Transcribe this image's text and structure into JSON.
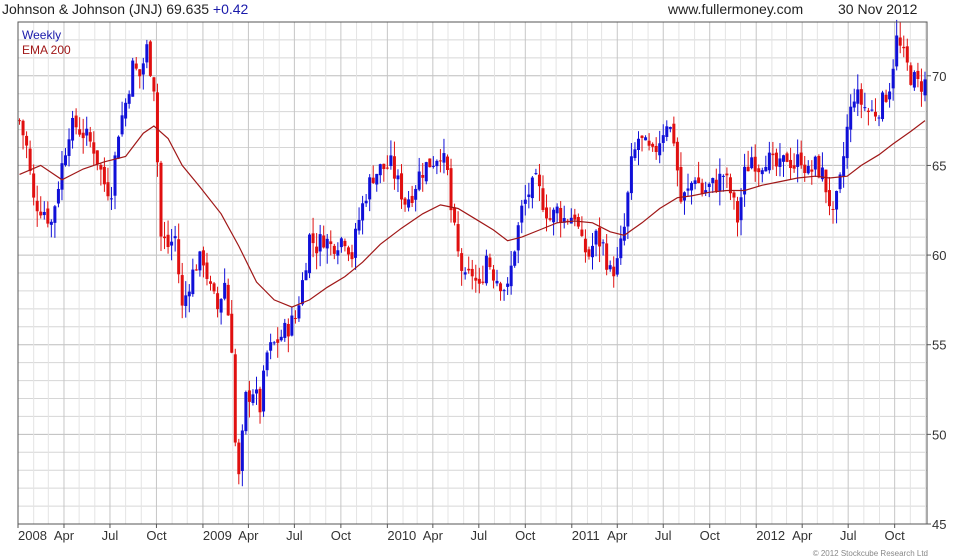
{
  "header": {
    "title": "Johnson & Johnson (JNJ)",
    "price": "69.635",
    "change": "+0.42",
    "site": "www.fullermoney.com",
    "date": "30 Nov 2012"
  },
  "legend": {
    "weekly": "Weekly",
    "ema": "EMA 200"
  },
  "copyright": "© 2012 Stockcube Research Ltd",
  "colors": {
    "up": "#1010d8",
    "down": "#e01010",
    "ema": "#a01818",
    "grid": "#d6d6d6",
    "axis": "#555555",
    "change": "#1a1aaa"
  },
  "chart_data": {
    "type": "candlestick",
    "frequency": "weekly",
    "ylim": [
      45,
      73
    ],
    "yticks": [
      45,
      50,
      55,
      60,
      65,
      70
    ],
    "xlim": [
      "2008-01-01",
      "2012-12-04"
    ],
    "xticks": [
      {
        "label": "2008",
        "date": "2008-01-01"
      },
      {
        "label": "Apr",
        "date": "2008-04-01"
      },
      {
        "label": "Jul",
        "date": "2008-07-01"
      },
      {
        "label": "Oct",
        "date": "2008-10-01"
      },
      {
        "label": "2009",
        "date": "2009-01-01"
      },
      {
        "label": "Apr",
        "date": "2009-04-01"
      },
      {
        "label": "Jul",
        "date": "2009-07-01"
      },
      {
        "label": "Oct",
        "date": "2009-10-01"
      },
      {
        "label": "2010",
        "date": "2010-01-01"
      },
      {
        "label": "Apr",
        "date": "2010-04-01"
      },
      {
        "label": "Jul",
        "date": "2010-07-01"
      },
      {
        "label": "Oct",
        "date": "2010-10-01"
      },
      {
        "label": "2011",
        "date": "2011-01-01"
      },
      {
        "label": "Apr",
        "date": "2011-04-01"
      },
      {
        "label": "Jul",
        "date": "2011-07-01"
      },
      {
        "label": "Oct",
        "date": "2011-10-01"
      },
      {
        "label": "2012",
        "date": "2012-01-01"
      },
      {
        "label": "Apr",
        "date": "2012-04-01"
      },
      {
        "label": "Jul",
        "date": "2012-07-01"
      },
      {
        "label": "Oct",
        "date": "2012-10-01"
      }
    ],
    "close_anchors": [
      [
        "2008-01-04",
        67.5
      ],
      [
        "2008-01-18",
        66.0
      ],
      [
        "2008-02-01",
        63.0
      ],
      [
        "2008-02-22",
        62.5
      ],
      [
        "2008-03-07",
        61.8
      ],
      [
        "2008-03-21",
        64.0
      ],
      [
        "2008-04-11",
        67.0
      ],
      [
        "2008-04-25",
        67.2
      ],
      [
        "2008-05-09",
        66.8
      ],
      [
        "2008-05-30",
        66.0
      ],
      [
        "2008-06-20",
        64.0
      ],
      [
        "2008-07-03",
        63.5
      ],
      [
        "2008-07-18",
        67.0
      ],
      [
        "2008-08-01",
        68.5
      ],
      [
        "2008-08-15",
        70.5
      ],
      [
        "2008-08-29",
        70.0
      ],
      [
        "2008-09-12",
        71.5
      ],
      [
        "2008-09-26",
        69.5
      ],
      [
        "2008-10-10",
        61.0
      ],
      [
        "2008-10-24",
        60.5
      ],
      [
        "2008-11-07",
        61.0
      ],
      [
        "2008-11-21",
        57.0
      ],
      [
        "2008-12-05",
        58.5
      ],
      [
        "2008-12-19",
        59.5
      ],
      [
        "2009-01-02",
        59.8
      ],
      [
        "2009-01-16",
        58.0
      ],
      [
        "2009-01-30",
        57.0
      ],
      [
        "2009-02-13",
        58.5
      ],
      [
        "2009-02-27",
        55.0
      ],
      [
        "2009-03-06",
        49.5
      ],
      [
        "2009-03-13",
        47.5
      ],
      [
        "2009-03-27",
        52.0
      ],
      [
        "2009-04-10",
        52.5
      ],
      [
        "2009-04-24",
        51.5
      ],
      [
        "2009-05-08",
        54.5
      ],
      [
        "2009-05-22",
        55.0
      ],
      [
        "2009-06-05",
        55.5
      ],
      [
        "2009-06-19",
        56.0
      ],
      [
        "2009-07-03",
        56.5
      ],
      [
        "2009-07-17",
        58.5
      ],
      [
        "2009-07-31",
        61.0
      ],
      [
        "2009-08-14",
        60.5
      ],
      [
        "2009-08-28",
        61.0
      ],
      [
        "2009-09-11",
        60.5
      ],
      [
        "2009-09-25",
        60.8
      ],
      [
        "2009-10-09",
        61.0
      ],
      [
        "2009-10-23",
        60.0
      ],
      [
        "2009-11-06",
        62.0
      ],
      [
        "2009-11-20",
        63.5
      ],
      [
        "2009-12-04",
        64.5
      ],
      [
        "2009-12-18",
        64.8
      ],
      [
        "2010-01-08",
        65.0
      ],
      [
        "2010-01-22",
        64.0
      ],
      [
        "2010-02-05",
        63.0
      ],
      [
        "2010-02-19",
        63.5
      ],
      [
        "2010-03-05",
        64.5
      ],
      [
        "2010-03-19",
        65.0
      ],
      [
        "2010-04-02",
        65.3
      ],
      [
        "2010-04-16",
        65.8
      ],
      [
        "2010-04-30",
        64.5
      ],
      [
        "2010-05-07",
        62.5
      ],
      [
        "2010-05-21",
        60.0
      ],
      [
        "2010-06-04",
        58.5
      ],
      [
        "2010-06-18",
        59.0
      ],
      [
        "2010-07-02",
        58.0
      ],
      [
        "2010-07-16",
        60.0
      ],
      [
        "2010-07-30",
        59.0
      ],
      [
        "2010-08-13",
        58.5
      ],
      [
        "2010-08-27",
        58.0
      ],
      [
        "2010-09-10",
        60.5
      ],
      [
        "2010-09-24",
        62.5
      ],
      [
        "2010-10-08",
        63.5
      ],
      [
        "2010-10-22",
        64.0
      ],
      [
        "2010-11-05",
        63.0
      ],
      [
        "2010-11-19",
        62.0
      ],
      [
        "2010-12-03",
        62.5
      ],
      [
        "2010-12-17",
        62.0
      ],
      [
        "2011-01-07",
        62.3
      ],
      [
        "2011-01-21",
        60.5
      ],
      [
        "2011-02-04",
        60.0
      ],
      [
        "2011-02-18",
        61.0
      ],
      [
        "2011-03-04",
        60.5
      ],
      [
        "2011-03-18",
        59.0
      ],
      [
        "2011-04-01",
        59.5
      ],
      [
        "2011-04-15",
        61.5
      ],
      [
        "2011-04-29",
        65.0
      ],
      [
        "2011-05-13",
        66.5
      ],
      [
        "2011-05-27",
        66.0
      ],
      [
        "2011-06-10",
        65.5
      ],
      [
        "2011-06-24",
        66.5
      ],
      [
        "2011-07-08",
        67.5
      ],
      [
        "2011-07-22",
        66.5
      ],
      [
        "2011-08-05",
        63.0
      ],
      [
        "2011-08-19",
        63.5
      ],
      [
        "2011-09-02",
        64.5
      ],
      [
        "2011-09-16",
        63.5
      ],
      [
        "2011-09-30",
        63.8
      ],
      [
        "2011-10-14",
        64.0
      ],
      [
        "2011-10-28",
        64.5
      ],
      [
        "2011-11-11",
        63.5
      ],
      [
        "2011-11-25",
        62.0
      ],
      [
        "2011-12-09",
        64.5
      ],
      [
        "2011-12-23",
        65.5
      ],
      [
        "2012-01-06",
        65.0
      ],
      [
        "2012-01-20",
        65.5
      ],
      [
        "2012-02-03",
        65.0
      ],
      [
        "2012-02-17",
        64.8
      ],
      [
        "2012-03-02",
        65.5
      ],
      [
        "2012-03-16",
        65.0
      ],
      [
        "2012-03-30",
        65.5
      ],
      [
        "2012-04-13",
        64.5
      ],
      [
        "2012-04-27",
        65.0
      ],
      [
        "2012-05-11",
        64.5
      ],
      [
        "2012-05-25",
        63.0
      ],
      [
        "2012-06-01",
        62.0
      ],
      [
        "2012-06-15",
        64.0
      ],
      [
        "2012-06-29",
        67.0
      ],
      [
        "2012-07-13",
        69.0
      ],
      [
        "2012-07-27",
        68.5
      ],
      [
        "2012-08-10",
        68.0
      ],
      [
        "2012-08-24",
        68.0
      ],
      [
        "2012-09-07",
        68.5
      ],
      [
        "2012-09-21",
        69.5
      ],
      [
        "2012-10-05",
        72.0
      ],
      [
        "2012-10-19",
        71.0
      ],
      [
        "2012-11-02",
        70.0
      ],
      [
        "2012-11-16",
        69.5
      ],
      [
        "2012-11-30",
        69.6
      ]
    ],
    "ema200": [
      [
        "2008-01-04",
        64.5
      ],
      [
        "2008-02-15",
        65.0
      ],
      [
        "2008-03-28",
        64.2
      ],
      [
        "2008-05-09",
        64.8
      ],
      [
        "2008-06-20",
        65.2
      ],
      [
        "2008-08-01",
        65.5
      ],
      [
        "2008-09-05",
        66.8
      ],
      [
        "2008-09-26",
        67.2
      ],
      [
        "2008-10-24",
        66.5
      ],
      [
        "2008-11-21",
        65.0
      ],
      [
        "2008-12-26",
        63.8
      ],
      [
        "2009-02-06",
        62.3
      ],
      [
        "2009-03-13",
        60.5
      ],
      [
        "2009-04-17",
        58.5
      ],
      [
        "2009-05-22",
        57.5
      ],
      [
        "2009-06-26",
        57.1
      ],
      [
        "2009-07-31",
        57.5
      ],
      [
        "2009-09-04",
        58.2
      ],
      [
        "2009-10-09",
        58.8
      ],
      [
        "2009-11-13",
        59.6
      ],
      [
        "2009-12-18",
        60.6
      ],
      [
        "2010-01-29",
        61.5
      ],
      [
        "2010-03-12",
        62.3
      ],
      [
        "2010-04-16",
        62.8
      ],
      [
        "2010-05-21",
        62.6
      ],
      [
        "2010-06-25",
        62.0
      ],
      [
        "2010-07-30",
        61.4
      ],
      [
        "2010-08-27",
        60.8
      ],
      [
        "2010-09-24",
        61.0
      ],
      [
        "2010-10-29",
        61.4
      ],
      [
        "2010-12-03",
        61.8
      ],
      [
        "2011-01-07",
        61.9
      ],
      [
        "2011-02-11",
        61.8
      ],
      [
        "2011-03-18",
        61.3
      ],
      [
        "2011-04-15",
        61.1
      ],
      [
        "2011-05-20",
        61.8
      ],
      [
        "2011-06-24",
        62.6
      ],
      [
        "2011-07-29",
        63.2
      ],
      [
        "2011-08-26",
        63.3
      ],
      [
        "2011-09-30",
        63.5
      ],
      [
        "2011-11-04",
        63.6
      ],
      [
        "2011-12-09",
        63.6
      ],
      [
        "2012-01-13",
        63.9
      ],
      [
        "2012-02-17",
        64.1
      ],
      [
        "2012-03-23",
        64.3
      ],
      [
        "2012-04-27",
        64.4
      ],
      [
        "2012-05-25",
        64.3
      ],
      [
        "2012-06-29",
        64.4
      ],
      [
        "2012-07-27",
        65.0
      ],
      [
        "2012-08-31",
        65.6
      ],
      [
        "2012-09-28",
        66.2
      ],
      [
        "2012-11-02",
        66.9
      ],
      [
        "2012-11-30",
        67.5
      ]
    ]
  }
}
